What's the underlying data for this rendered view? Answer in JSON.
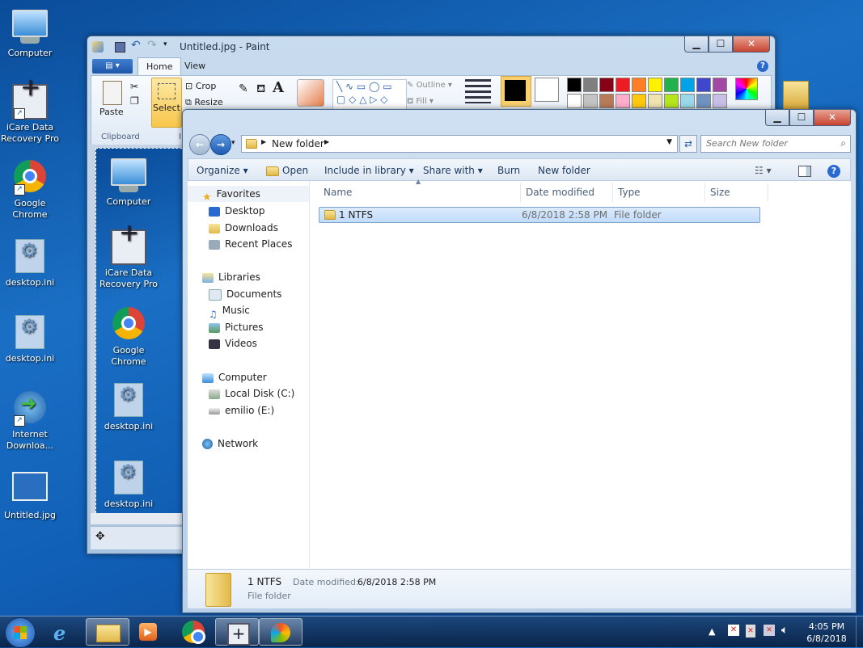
{
  "desktop_icons": [
    {
      "label": "Computer",
      "type": "computer"
    },
    {
      "label": "iCare Data Recovery Pro",
      "type": "icare"
    },
    {
      "label": "Google Chrome",
      "type": "chrome"
    },
    {
      "label": "desktop.ini",
      "type": "ini"
    },
    {
      "label": "desktop.ini",
      "type": "ini"
    },
    {
      "label": "Internet Downloa...",
      "type": "idm"
    },
    {
      "label": "Untitled.jpg",
      "type": "jpg"
    }
  ],
  "paint": {
    "title": "Untitled.jpg - Paint",
    "tabs": {
      "home": "Home",
      "view": "View"
    },
    "paste": "Paste",
    "clipboard": "Clipboard",
    "select": "Select",
    "image_group": "Image",
    "crop": "Crop",
    "resize": "Resize",
    "outline": "Outline",
    "fill": "Fill",
    "canvas_icons": [
      {
        "label": "Computer"
      },
      {
        "label": "iCare Data Recovery Pro"
      },
      {
        "label": "Google Chrome"
      },
      {
        "label": "desktop.ini"
      },
      {
        "label": "desktop.ini"
      }
    ],
    "palette": [
      "#000000",
      "#7f7f7f",
      "#880015",
      "#ed1c24",
      "#ff7f27",
      "#fff200",
      "#22b14c",
      "#00a2e8",
      "#3f48cc",
      "#a349a4"
    ],
    "palette2": [
      "#ffffff",
      "#c3c3c3",
      "#b97a57",
      "#ffaec9",
      "#ffc90e",
      "#efe4b0",
      "#b5e61d",
      "#99d9ea",
      "#7092be",
      "#c8bfe7"
    ]
  },
  "explorer": {
    "address": "New folder",
    "search_placeholder": "Search New folder",
    "toolbar": {
      "organize": "Organize",
      "open": "Open",
      "include": "Include in library",
      "share": "Share with",
      "burn": "Burn",
      "new_folder": "New folder"
    },
    "nav": {
      "favorites": "Favorites",
      "desktop": "Desktop",
      "downloads": "Downloads",
      "recent": "Recent Places",
      "libraries": "Libraries",
      "documents": "Documents",
      "music": "Music",
      "pictures": "Pictures",
      "videos": "Videos",
      "computer": "Computer",
      "local_disk": "Local Disk (C:)",
      "emilio": "emilio (E:)",
      "network": "Network"
    },
    "columns": {
      "name": "Name",
      "date": "Date modified",
      "type": "Type",
      "size": "Size"
    },
    "files": [
      {
        "name": "1 NTFS",
        "date": "6/8/2018 2:58 PM",
        "type": "File folder",
        "size": ""
      }
    ],
    "details": {
      "name": "1 NTFS",
      "date_label": "Date modified:",
      "date_value": "6/8/2018 2:58 PM",
      "type": "File folder"
    }
  },
  "taskbar": {
    "time": "4:05 PM",
    "date": "6/8/2018"
  }
}
